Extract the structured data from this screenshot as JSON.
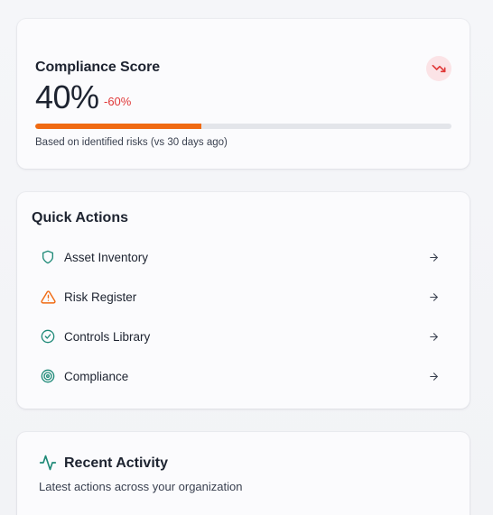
{
  "compliance_score": {
    "title": "Compliance Score",
    "value": "40%",
    "value_fraction": 0.4,
    "delta": "-60%",
    "caption": "Based on identified risks (vs 30 days ago)",
    "trend_icon": "trending-down-icon",
    "colors": {
      "delta": "#e03838",
      "progress": "#f06a12",
      "track": "#e3e5ea",
      "trend_badge": "#fbe3e6"
    }
  },
  "quick_actions": {
    "title": "Quick Actions",
    "items": [
      {
        "label": "Asset Inventory",
        "icon": "shield-icon",
        "color": "#1f8a78"
      },
      {
        "label": "Risk Register",
        "icon": "alert-triangle-icon",
        "color": "#f06a12"
      },
      {
        "label": "Controls Library",
        "icon": "check-circle-icon",
        "color": "#1f8a78"
      },
      {
        "label": "Compliance",
        "icon": "target-icon",
        "color": "#1f8a78"
      }
    ],
    "arrow_icon": "arrow-right-icon"
  },
  "recent_activity": {
    "title": "Recent Activity",
    "subtitle": "Latest actions across your organization",
    "icon": "activity-icon",
    "color": "#1f8a78"
  }
}
